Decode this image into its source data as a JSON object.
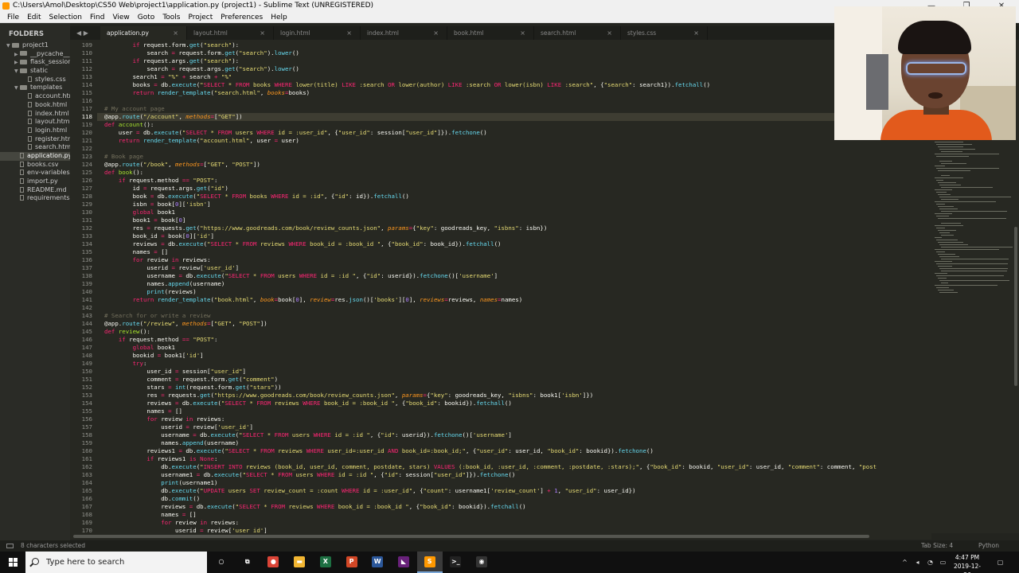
{
  "window": {
    "title": "C:\\Users\\Amol\\Desktop\\CS50 Web\\project1\\application.py (project1) - Sublime Text (UNREGISTERED)",
    "controls": [
      "—",
      "❐",
      "✕"
    ]
  },
  "menu": [
    "File",
    "Edit",
    "Selection",
    "Find",
    "View",
    "Goto",
    "Tools",
    "Project",
    "Preferences",
    "Help"
  ],
  "sidebar": {
    "header": "FOLDERS",
    "items": [
      {
        "label": "project1",
        "depth": 0,
        "type": "folder",
        "open": true
      },
      {
        "label": "__pycache__",
        "depth": 1,
        "type": "folder",
        "open": false
      },
      {
        "label": "flask_session",
        "depth": 1,
        "type": "folder",
        "open": false
      },
      {
        "label": "static",
        "depth": 1,
        "type": "folder",
        "open": true
      },
      {
        "label": "styles.css",
        "depth": 2,
        "type": "file"
      },
      {
        "label": "templates",
        "depth": 1,
        "type": "folder",
        "open": true
      },
      {
        "label": "account.html",
        "depth": 2,
        "type": "file"
      },
      {
        "label": "book.html",
        "depth": 2,
        "type": "file"
      },
      {
        "label": "index.html",
        "depth": 2,
        "type": "file"
      },
      {
        "label": "layout.html",
        "depth": 2,
        "type": "file"
      },
      {
        "label": "login.html",
        "depth": 2,
        "type": "file"
      },
      {
        "label": "register.html",
        "depth": 2,
        "type": "file"
      },
      {
        "label": "search.html",
        "depth": 2,
        "type": "file"
      },
      {
        "label": "application.py",
        "depth": 1,
        "type": "file",
        "selected": true
      },
      {
        "label": "books.csv",
        "depth": 1,
        "type": "file"
      },
      {
        "label": "env-variables",
        "depth": 1,
        "type": "file"
      },
      {
        "label": "import.py",
        "depth": 1,
        "type": "file"
      },
      {
        "label": "README.md",
        "depth": 1,
        "type": "file"
      },
      {
        "label": "requirements.txt",
        "depth": 1,
        "type": "file"
      }
    ]
  },
  "tabs": [
    {
      "label": "application.py",
      "active": true
    },
    {
      "label": "layout.html",
      "active": false
    },
    {
      "label": "login.html",
      "active": false
    },
    {
      "label": "index.html",
      "active": false
    },
    {
      "label": "book.html",
      "active": false
    },
    {
      "label": "search.html",
      "active": false
    },
    {
      "label": "styles.css",
      "active": false
    }
  ],
  "tab_nav": "◀ ▶",
  "tab_close": "×",
  "editor": {
    "current_line": 118,
    "lines": [
      {
        "n": 109,
        "t": "        if request.form.get(\"search\"):"
      },
      {
        "n": 110,
        "t": "            search = request.form.get(\"search\").lower()"
      },
      {
        "n": 111,
        "t": "        if request.args.get(\"search\"):"
      },
      {
        "n": 112,
        "t": "            search = request.args.get(\"search\").lower()"
      },
      {
        "n": 113,
        "t": "        search1 = \"%\" + search + \"%\""
      },
      {
        "n": 114,
        "t": "        books = db.execute(\"SELECT * FROM books WHERE lower(title) LIKE :search OR lower(author) LIKE :search OR lower(isbn) LIKE :search\", {\"search\": search1}).fetchall()"
      },
      {
        "n": 115,
        "t": "        return render_template(\"search.html\", books=books)"
      },
      {
        "n": 116,
        "t": ""
      },
      {
        "n": 117,
        "t": "# My account page"
      },
      {
        "n": 118,
        "t": "@app.route(\"/account\", methods=[\"GET\"])"
      },
      {
        "n": 119,
        "t": "def account():"
      },
      {
        "n": 120,
        "t": "    user = db.execute(\"SELECT * FROM users WHERE id = :user_id\", {\"user_id\": session[\"user_id\"]}).fetchone()"
      },
      {
        "n": 121,
        "t": "    return render_template(\"account.html\", user = user)"
      },
      {
        "n": 122,
        "t": ""
      },
      {
        "n": 123,
        "t": "# Book page"
      },
      {
        "n": 124,
        "t": "@app.route(\"/book\", methods=[\"GET\", \"POST\"])"
      },
      {
        "n": 125,
        "t": "def book():"
      },
      {
        "n": 126,
        "t": "    if request.method == \"POST\":"
      },
      {
        "n": 127,
        "t": "        id = request.args.get(\"id\")"
      },
      {
        "n": 128,
        "t": "        book = db.execute(\"SELECT * FROM books WHERE id = :id\", {\"id\": id}).fetchall()"
      },
      {
        "n": 129,
        "t": "        isbn = book[0]['isbn']"
      },
      {
        "n": 130,
        "t": "        global book1"
      },
      {
        "n": 131,
        "t": "        book1 = book[0]"
      },
      {
        "n": 132,
        "t": "        res = requests.get(\"https://www.goodreads.com/book/review_counts.json\", params={\"key\": goodreads_key, \"isbns\": isbn})"
      },
      {
        "n": 133,
        "t": "        book_id = book[0]['id']"
      },
      {
        "n": 134,
        "t": "        reviews = db.execute(\"SELECT * FROM reviews WHERE book_id = :book_id \", {\"book_id\": book_id}).fetchall()"
      },
      {
        "n": 135,
        "t": "        names = []"
      },
      {
        "n": 136,
        "t": "        for review in reviews:"
      },
      {
        "n": 137,
        "t": "            userid = review['user_id']"
      },
      {
        "n": 138,
        "t": "            username = db.execute(\"SELECT * FROM users WHERE id = :id \", {\"id\": userid}).fetchone()['username']"
      },
      {
        "n": 139,
        "t": "            names.append(username)"
      },
      {
        "n": 140,
        "t": "            print(reviews)"
      },
      {
        "n": 141,
        "t": "        return render_template(\"book.html\", book=book[0], review=res.json()['books'][0], reviews=reviews, names=names)"
      },
      {
        "n": 142,
        "t": ""
      },
      {
        "n": 143,
        "t": "# Search for or write a review"
      },
      {
        "n": 144,
        "t": "@app.route(\"/review\", methods=[\"GET\", \"POST\"])"
      },
      {
        "n": 145,
        "t": "def review():"
      },
      {
        "n": 146,
        "t": "    if request.method == \"POST\":"
      },
      {
        "n": 147,
        "t": "        global book1"
      },
      {
        "n": 148,
        "t": "        bookid = book1['id']"
      },
      {
        "n": 149,
        "t": "        try:"
      },
      {
        "n": 150,
        "t": "            user_id = session[\"user_id\"]"
      },
      {
        "n": 151,
        "t": "            comment = request.form.get(\"comment\")"
      },
      {
        "n": 152,
        "t": "            stars = int(request.form.get(\"stars\"))"
      },
      {
        "n": 153,
        "t": "            res = requests.get(\"https://www.goodreads.com/book/review_counts.json\", params={\"key\": goodreads_key, \"isbns\": book1['isbn']})"
      },
      {
        "n": 154,
        "t": "            reviews = db.execute(\"SELECT * FROM reviews WHERE book_id = :book_id \", {\"book_id\": bookid}).fetchall()"
      },
      {
        "n": 155,
        "t": "            names = []"
      },
      {
        "n": 156,
        "t": "            for review in reviews:"
      },
      {
        "n": 157,
        "t": "                userid = review['user_id']"
      },
      {
        "n": 158,
        "t": "                username = db.execute(\"SELECT * FROM users WHERE id = :id \", {\"id\": userid}).fetchone()['username']"
      },
      {
        "n": 159,
        "t": "                names.append(username)"
      },
      {
        "n": 160,
        "t": "            reviews1 = db.execute(\"SELECT * FROM reviews WHERE user_id=:user_id AND book_id=:book_id;\", {\"user_id\": user_id, \"book_id\": bookid}).fetchone()"
      },
      {
        "n": 161,
        "t": "            if reviews1 is None:"
      },
      {
        "n": 162,
        "t": "                db.execute(\"INSERT INTO reviews (book_id, user_id, comment, postdate, stars) VALUES (:book_id, :user_id, :comment, :postdate, :stars);\", {\"book_id\": bookid, \"user_id\": user_id, \"comment\": comment, \"post"
      },
      {
        "n": 163,
        "t": "                username1 = db.execute(\"SELECT * FROM users WHERE id = :id \", {\"id\": session[\"user_id\"]}).fetchone()"
      },
      {
        "n": 164,
        "t": "                print(username1)"
      },
      {
        "n": 165,
        "t": "                db.execute(\"UPDATE users SET review_count = :count WHERE id = :user_id\", {\"count\": username1['review_count'] + 1, \"user_id\": user_id})"
      },
      {
        "n": 166,
        "t": "                db.commit()"
      },
      {
        "n": 167,
        "t": "                reviews = db.execute(\"SELECT * FROM reviews WHERE book_id = :book_id \", {\"book_id\": bookid}).fetchall()"
      },
      {
        "n": 168,
        "t": "                names = []"
      },
      {
        "n": 169,
        "t": "                for review in reviews:"
      },
      {
        "n": 170,
        "t": "                    userid = review['user_id']"
      }
    ]
  },
  "status": {
    "selection": "8 characters selected",
    "tab_size": "Tab Size: 4",
    "syntax": "Python"
  },
  "taskbar": {
    "search_placeholder": "Type here to search",
    "apps": [
      {
        "name": "cortana-icon",
        "glyph": "○",
        "color": "transparent"
      },
      {
        "name": "task-view-icon",
        "glyph": "⧉",
        "color": "transparent"
      },
      {
        "name": "chrome-icon",
        "glyph": "●",
        "color": "#db4437"
      },
      {
        "name": "file-explorer-icon",
        "glyph": "▬",
        "color": "#f2b632"
      },
      {
        "name": "excel-icon",
        "glyph": "X",
        "color": "#1d6f42"
      },
      {
        "name": "powerpoint-icon",
        "glyph": "P",
        "color": "#d24726"
      },
      {
        "name": "word-icon",
        "glyph": "W",
        "color": "#2b579a"
      },
      {
        "name": "visual-studio-icon",
        "glyph": "◣",
        "color": "#68217a"
      },
      {
        "name": "sublime-text-icon",
        "glyph": "S",
        "color": "#ff9800",
        "active": true
      },
      {
        "name": "terminal-icon",
        "glyph": ">_",
        "color": "#222"
      },
      {
        "name": "obs-icon",
        "glyph": "◉",
        "color": "#333"
      }
    ],
    "time": "4:47 PM",
    "date": "2019-12-26"
  }
}
